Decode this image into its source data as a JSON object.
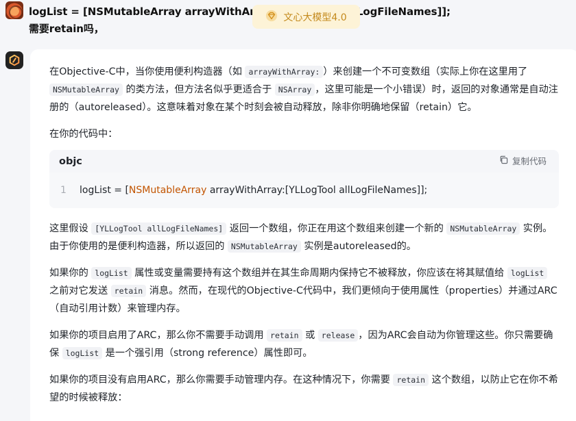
{
  "user_message": {
    "line1": "logList = [NSMutableArray arrayWithArray:[YLLogTool allLogFileNames]];",
    "line2": "需要retain吗，"
  },
  "model_badge": {
    "label": "文心大模型4.0"
  },
  "answer": {
    "p1": [
      "在Objective-C中，当你使用便利构造器（如 ",
      "arrayWithArray:",
      "）来创建一个不可变数组（实际上你在这里用了 ",
      "NSMutableArray",
      " 的类方法，但方法名似乎更适合于 ",
      "NSArray",
      "，这里可能是一个小错误）时，返回的对象通常是自动注册的（autoreleased）。这意味着对象在某个时刻会被自动释放，除非你明确地保留（retain）它。"
    ],
    "p2": "在你的代码中：",
    "code_block": {
      "language": "objc",
      "copy_label": "复制代码",
      "line_number": "1",
      "code_prefix": "logList = [",
      "code_type": "NSMutableArray",
      "code_suffix": " arrayWithArray:[YLLogTool allLogFileNames]];"
    },
    "p3": [
      "这里假设 ",
      "[YLLogTool allLogFileNames]",
      " 返回一个数组，你正在用这个数组来创建一个新的 ",
      "NSMutableArray",
      " 实例。由于你使用的是便利构造器，所以返回的 ",
      "NSMutableArray",
      " 实例是autoreleased的。"
    ],
    "p4": [
      "如果你的 ",
      "logList",
      " 属性或变量需要持有这个数组并在其生命周期内保持它不被释放，你应该在将其赋值给 ",
      "logList",
      " 之前对它发送 ",
      "retain",
      " 消息。然而，在现代的Objective-C代码中，我们更倾向于使用属性（properties）并通过ARC（自动引用计数）来管理内存。"
    ],
    "p5": [
      "如果你的项目启用了ARC，那么你不需要手动调用 ",
      "retain",
      " 或 ",
      "release",
      "，因为ARC会自动为你管理这些。你只需要确保 ",
      "logList",
      " 是一个强引用（strong reference）属性即可。"
    ],
    "p6": [
      "如果你的项目没有启用ARC，那么你需要手动管理内存。在这种情况下，你需要 ",
      "retain",
      " 这个数组，以防止它在你不希望的时候被释放："
    ]
  }
}
